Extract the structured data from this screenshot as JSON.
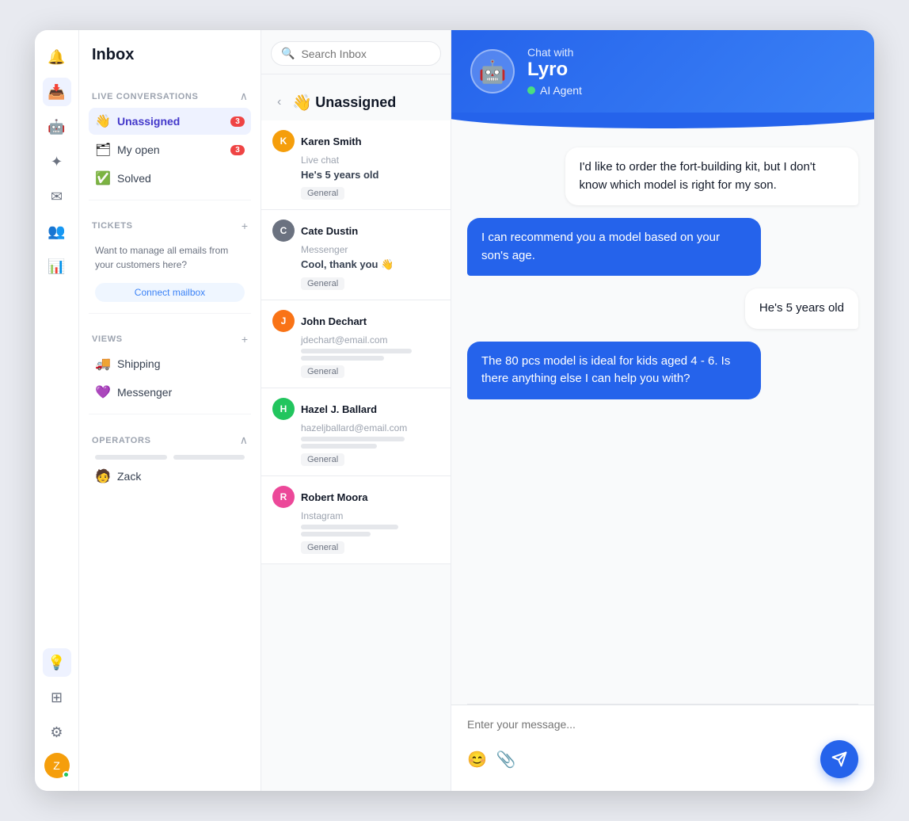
{
  "app": {
    "title": "Inbox"
  },
  "icon_nav": {
    "icons": [
      {
        "name": "bell-icon",
        "symbol": "🔔",
        "active": false
      },
      {
        "name": "inbox-icon",
        "symbol": "📥",
        "active": true
      },
      {
        "name": "bot-icon",
        "symbol": "🤖",
        "active": false
      },
      {
        "name": "flow-icon",
        "symbol": "⚙",
        "active": false
      },
      {
        "name": "email-icon",
        "symbol": "✉",
        "active": false
      },
      {
        "name": "team-icon",
        "symbol": "👥",
        "active": false
      },
      {
        "name": "chart-icon",
        "symbol": "📊",
        "active": false
      }
    ],
    "bottom_icons": [
      {
        "name": "bulb-icon",
        "symbol": "💡"
      },
      {
        "name": "grid-icon",
        "symbol": "⊞"
      },
      {
        "name": "gear-icon",
        "symbol": "⚙"
      }
    ]
  },
  "sidebar": {
    "title": "Inbox",
    "live_conversations_section": "LIVE CONVERSATIONS",
    "tickets_section": "TICKETS",
    "views_section": "VIEWS",
    "operators_section": "OPERATORS",
    "items": [
      {
        "label": "Unassigned",
        "icon": "👋",
        "badge": 3,
        "active": true
      },
      {
        "label": "My open",
        "icon": "🗂",
        "badge": 3,
        "active": false
      },
      {
        "label": "Solved",
        "icon": "✅",
        "badge": null,
        "active": false
      }
    ],
    "tickets_text": "Want to manage all emails from your customers here?",
    "connect_mailbox_label": "Connect mailbox",
    "views": [
      {
        "label": "Shipping",
        "icon": "🚚"
      },
      {
        "label": "Messenger",
        "icon": "💜"
      }
    ],
    "operators": [
      {
        "label": "Zack",
        "icon": "🧑"
      }
    ]
  },
  "inbox_panel": {
    "search_placeholder": "Search Inbox",
    "tabs": [
      {
        "label": "Unassigned",
        "active": true
      }
    ],
    "unassigned_title": "Unassigned",
    "unassigned_emoji": "👋",
    "conversations": [
      {
        "name": "Karen Smith",
        "source": "Live chat",
        "preview": "He's 5 years old",
        "tag": "General",
        "avatar_bg": "#f59e0b",
        "avatar_letter": "K",
        "has_lines": false
      },
      {
        "name": "Cate Dustin",
        "source": "Messenger",
        "preview": "Cool, thank you 👋",
        "tag": "General",
        "avatar_bg": "#6b7280",
        "avatar_letter": "C",
        "has_lines": false
      },
      {
        "name": "John Dechart",
        "source": "jdechart@email.com",
        "preview": null,
        "tag": "General",
        "avatar_bg": "#f97316",
        "avatar_letter": "J",
        "has_lines": true
      },
      {
        "name": "Hazel J. Ballard",
        "source": "hazeljballard@email.com",
        "preview": null,
        "tag": "General",
        "avatar_bg": "#22c55e",
        "avatar_letter": "H",
        "has_lines": true
      },
      {
        "name": "Robert Moora",
        "source": "Instagram",
        "preview": null,
        "tag": "General",
        "avatar_bg": "#ec4899",
        "avatar_letter": "R",
        "has_lines": true
      }
    ]
  },
  "chat": {
    "chat_with_label": "Chat with",
    "bot_name": "Lyro",
    "ai_agent_label": "AI Agent",
    "messages": [
      {
        "type": "user",
        "text": "I'd like to order the fort-building kit, but I don't know which model is right for my son."
      },
      {
        "type": "bot",
        "text": "I can recommend you a model based on your son's age."
      },
      {
        "type": "user",
        "text": "He's 5 years old"
      },
      {
        "type": "bot",
        "text": "The 80 pcs model is ideal for kids aged 4 - 6. Is there anything else I can help you with?"
      }
    ],
    "input_placeholder": "Enter your message...",
    "send_button_label": "Send"
  }
}
